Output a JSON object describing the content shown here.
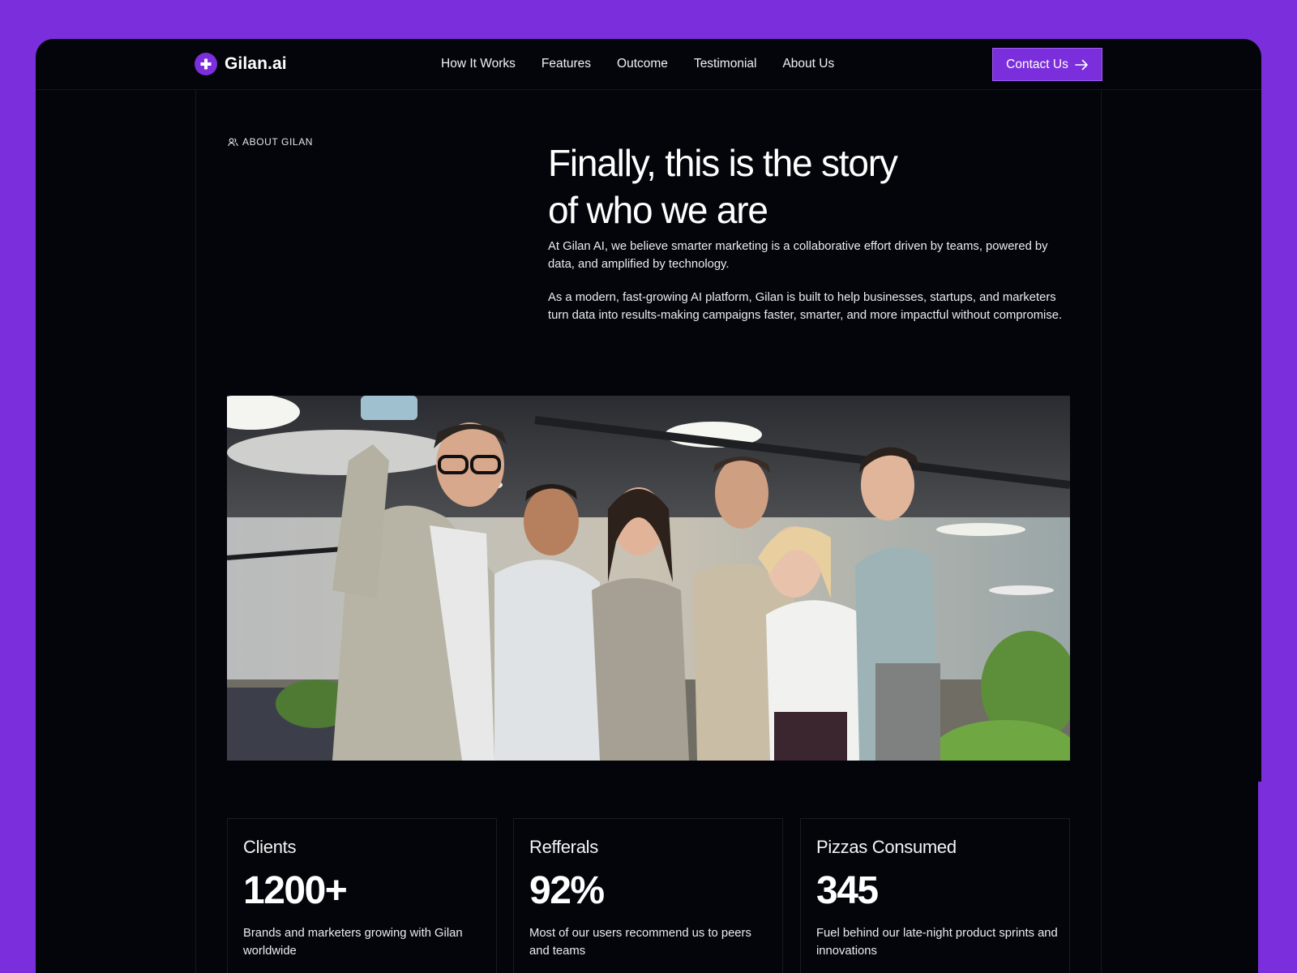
{
  "brand": {
    "name": "Gilan.ai",
    "accent": "#7b2fdc",
    "background": "#04050a"
  },
  "nav": {
    "links": [
      "How It Works",
      "Features",
      "Outcome",
      "Testimonial",
      "About Us"
    ],
    "cta_label": "Contact Us",
    "cta_icon": "arrow-right-icon"
  },
  "about": {
    "eyebrow": "ABOUT GILAN",
    "eyebrow_icon": "users-icon",
    "headline_line1": "Finally, this is the story",
    "headline_line2": "of who we are",
    "paragraph1": "At Gilan AI, we believe smarter marketing is a collaborative effort driven by teams, powered by data, and amplified by technology.",
    "paragraph2": "As a modern, fast-growing AI platform, Gilan is built to help businesses, startups, and marketers turn data into results-making campaigns faster, smarter, and more impactful without compromise."
  },
  "stats": [
    {
      "title": "Clients",
      "value": "1200+",
      "description": "Brands and marketers growing with Gilan worldwide"
    },
    {
      "title": "Refferals",
      "value": "92%",
      "description": "Most of our users recommend us to peers and teams"
    },
    {
      "title": "Pizzas Consumed",
      "value": "345",
      "description": "Fuel behind our late-night product sprints and innovations"
    }
  ]
}
